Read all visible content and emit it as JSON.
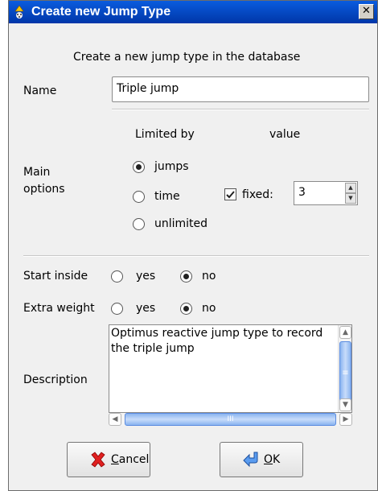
{
  "window": {
    "title": "Create new Jump Type",
    "close_glyph": "✕"
  },
  "header": {
    "subtitle": "Create a new jump type in the database"
  },
  "name": {
    "label": "Name",
    "value": "Triple jump"
  },
  "main_options": {
    "label_line1": "Main",
    "label_line2": "options",
    "limited_by_header": "Limited by",
    "value_header": "value",
    "radios": [
      {
        "label": "jumps",
        "checked": true
      },
      {
        "label": "time",
        "checked": false
      },
      {
        "label": "unlimited",
        "checked": false
      }
    ],
    "fixed": {
      "label": "fixed:",
      "checked": true,
      "value": "3"
    }
  },
  "start_inside": {
    "label": "Start inside",
    "yes": "yes",
    "no": "no",
    "selected": "no"
  },
  "extra_weight": {
    "label": "Extra weight",
    "yes": "yes",
    "no": "no",
    "selected": "no"
  },
  "description": {
    "label": "Description",
    "value": "Optimus reactive  jump type to record the triple jump",
    "h_thumb_mark": "III",
    "v_thumb_mark": "≡"
  },
  "buttons": {
    "cancel": {
      "mnemonic": "C",
      "rest": "ancel",
      "icon": "red-x-icon"
    },
    "ok": {
      "mnemonic": "O",
      "rest": "K",
      "icon": "enter-arrow-icon"
    }
  },
  "colors": {
    "titlebar": "#0a5cde",
    "scroll_thumb": "#8ab4f0",
    "cancel_icon": "#e02020",
    "ok_icon": "#3b7ee0"
  }
}
